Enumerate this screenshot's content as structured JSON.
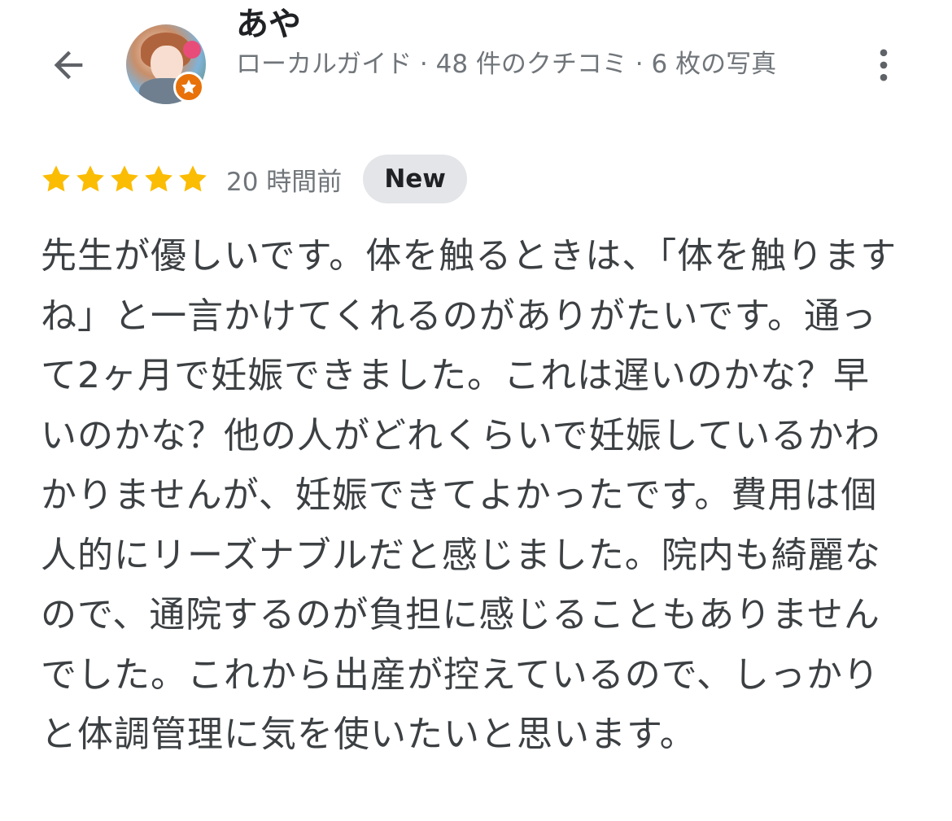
{
  "header": {
    "back_icon": "arrow-back-icon",
    "reviewer_name": "あや",
    "reviewer_meta": "ローカルガイド · 48 件のクチコミ · 6 枚の写真",
    "badge_icon": "star-icon",
    "badge_color": "#e8710a",
    "more_icon": "more-vert-icon"
  },
  "review": {
    "rating": 5,
    "max_rating": 5,
    "star_color": "#fbbc04",
    "timestamp": "20 時間前",
    "new_label": "New",
    "text": "先生が優しいです。体を触るときは、「体を触りますね」と一言かけてくれるのがありがたいです。通って2ヶ月で妊娠できました。これは遅いのかな？早いのかな？他の人がどれくらいで妊娠しているかわかりませんが、妊娠できてよかったです。費用は個人的にリーズナブルだと感じました。院内も綺麗なので、通院するのが負担に感じることもありませんでした。これから出産が控えているので、しっかりと体調管理に気を使いたいと思います。"
  }
}
